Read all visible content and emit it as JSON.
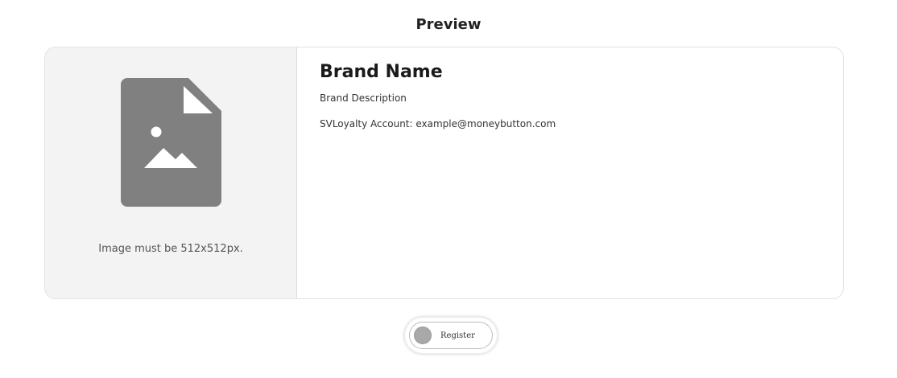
{
  "preview": {
    "heading": "Preview"
  },
  "card": {
    "image_hint": "Image must be 512x512px.",
    "brand_name": "Brand Name",
    "brand_description": "Brand Description",
    "account_line": "SVLoyalty Account: example@moneybutton.com",
    "placeholder_icon": "image-file-icon"
  },
  "register": {
    "label": "Register",
    "checked": false
  },
  "colors": {
    "icon_fill": "#808080",
    "placeholder_bg": "#f3f3f3",
    "knob": "#a9a9a9"
  }
}
